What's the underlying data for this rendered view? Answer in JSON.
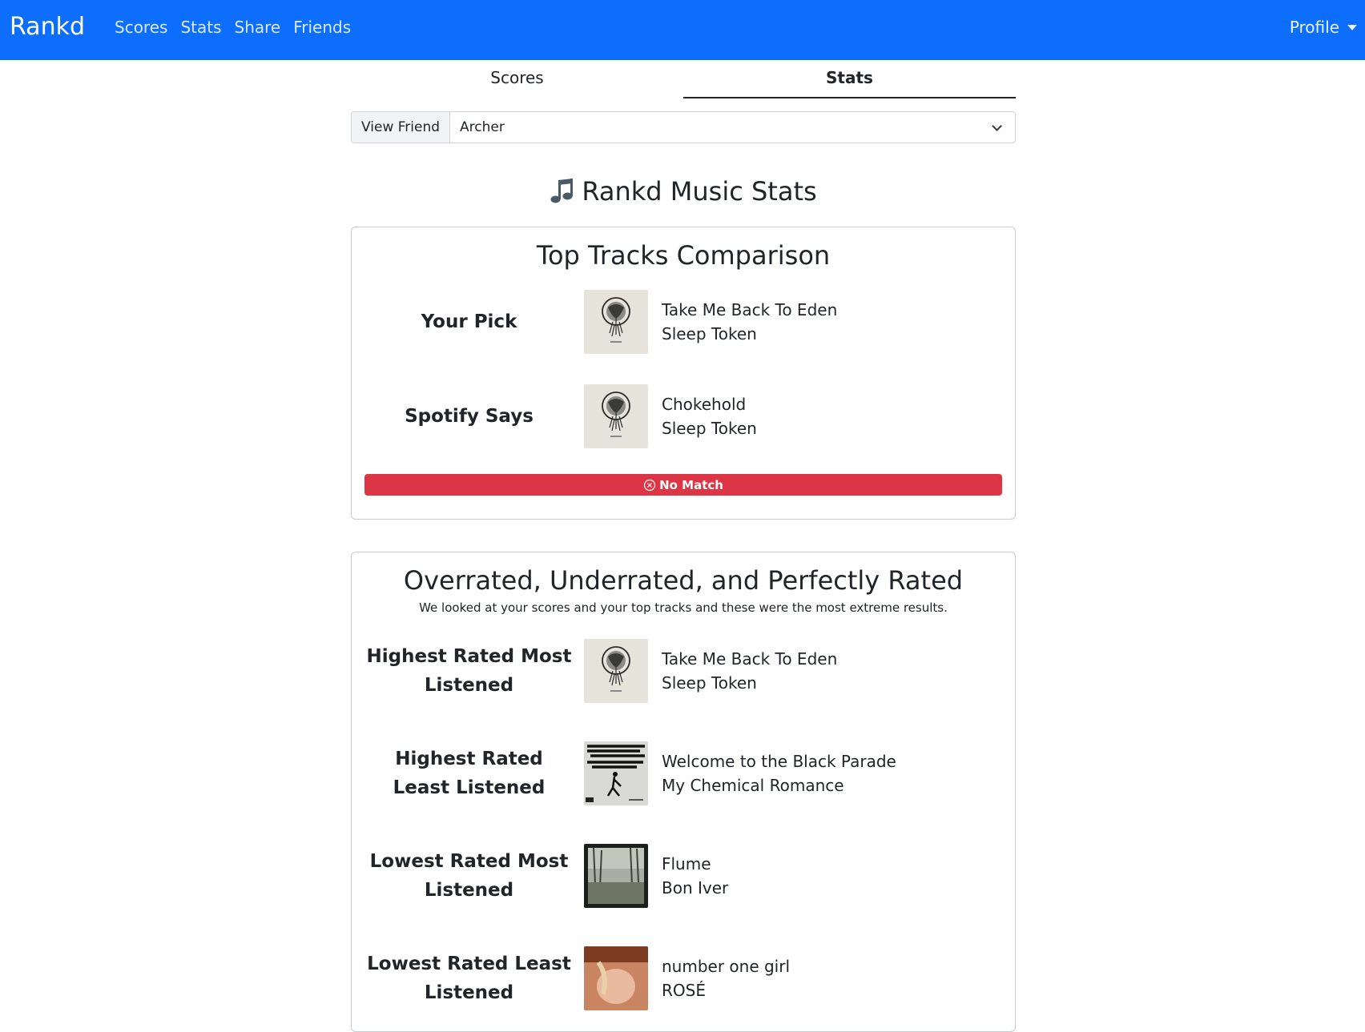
{
  "navbar": {
    "brand": "Rankd",
    "links": [
      "Scores",
      "Stats",
      "Share",
      "Friends"
    ],
    "profile_label": "Profile",
    "color": "#0d6efd"
  },
  "tabs": [
    "Scores",
    "Stats"
  ],
  "friend_select": {
    "label": "View Friend",
    "value": "Archer"
  },
  "page_title": "Rankd Music Stats",
  "top_tracks": {
    "title": "Top Tracks Comparison",
    "rows": [
      {
        "label": "Your Pick",
        "track": "Take Me Back To Eden",
        "artist": "Sleep Token",
        "art": "sleep-token-album-art"
      },
      {
        "label": "Spotify Says",
        "track": "Chokehold",
        "artist": "Sleep Token",
        "art": "sleep-token-album-art"
      }
    ],
    "match_status": "No Match",
    "match_color": "#dc3545"
  },
  "rated": {
    "title": "Overrated, Underrated, and Perfectly Rated",
    "subtitle": "We looked at your scores and your top tracks and these were the most extreme results.",
    "rows": [
      {
        "label": "Highest Rated Most Listened",
        "track": "Take Me Back To Eden",
        "artist": "Sleep Token",
        "art": "sleep-token-album-art"
      },
      {
        "label": "Highest Rated Least Listened",
        "track": "Welcome to the Black Parade",
        "artist": "My Chemical Romance",
        "art": "black-parade-album-art"
      },
      {
        "label": "Lowest Rated Most Listened",
        "track": "Flume",
        "artist": "Bon Iver",
        "art": "bon-iver-album-art"
      },
      {
        "label": "Lowest Rated Least Listened",
        "track": "number one girl",
        "artist": "ROSÉ",
        "art": "rose-album-art"
      }
    ]
  }
}
